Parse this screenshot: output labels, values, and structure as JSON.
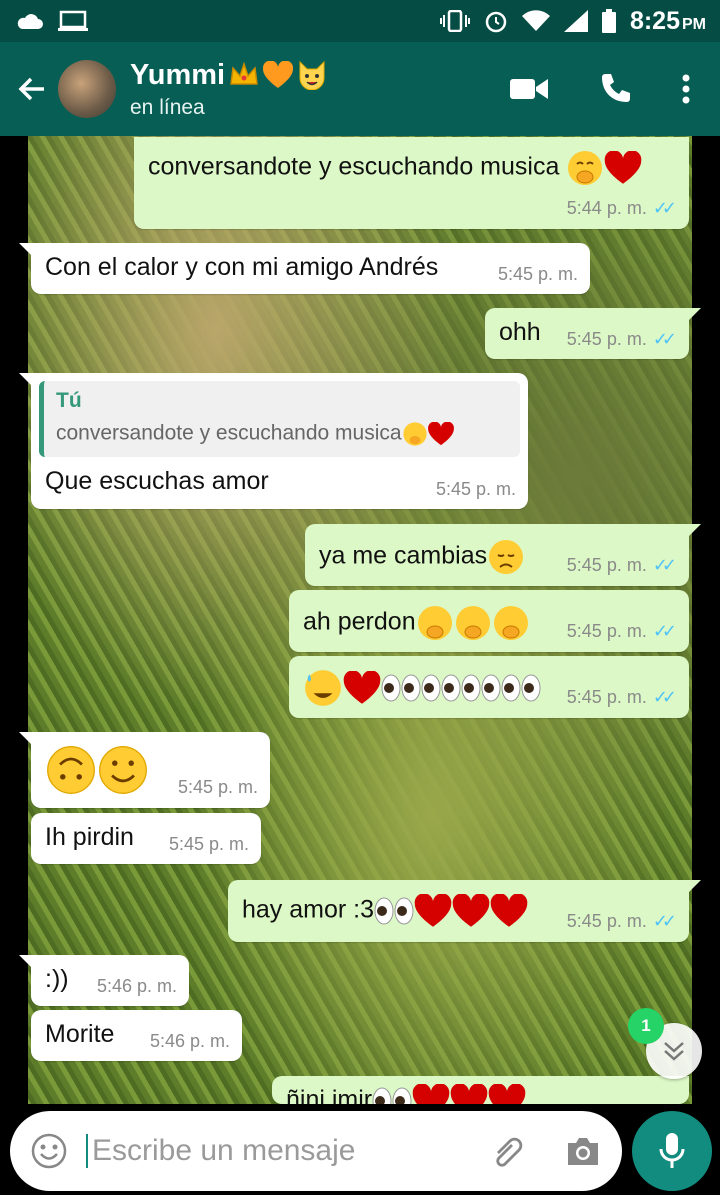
{
  "status_bar": {
    "time": "8:25",
    "ampm": "PM"
  },
  "header": {
    "name": "Yummi",
    "status": "en línea"
  },
  "messages": [
    {
      "dir": "out",
      "text": "conversandote y escuchando musica",
      "time": "5:44 p. m."
    },
    {
      "dir": "in",
      "text": "Con el calor y con mi amigo Andrés",
      "time": "5:45 p. m."
    },
    {
      "dir": "out",
      "text": "ohh",
      "time": "5:45 p. m."
    },
    {
      "dir": "in",
      "quote_author": "Tú",
      "quote_text": "conversandote y escuchando musica",
      "text": "Que escuchas amor",
      "time": "5:45 p. m."
    },
    {
      "dir": "out",
      "text": "ya me cambias",
      "time": "5:45 p. m."
    },
    {
      "dir": "out",
      "text": "ah perdon",
      "time": "5:45 p. m."
    },
    {
      "dir": "out",
      "text": "",
      "time": "5:45 p. m."
    },
    {
      "dir": "in",
      "text": "",
      "time": "5:45 p. m."
    },
    {
      "dir": "in",
      "text": "Ih pirdin",
      "time": "5:45 p. m."
    },
    {
      "dir": "out",
      "text": "hay amor :3",
      "time": "5:45 p. m."
    },
    {
      "dir": "in",
      "text": ":))",
      "time": "5:46 p. m."
    },
    {
      "dir": "in",
      "text": "Morite",
      "time": "5:46 p. m."
    },
    {
      "dir": "out",
      "text": "ñini imir",
      "time": ""
    }
  ],
  "unread_count": "1",
  "composer": {
    "placeholder": "Escribe un mensaje"
  },
  "colors": {
    "header": "#075e54",
    "status_bar": "#054d44",
    "outgoing": "#dcf8c6",
    "incoming": "#ffffff",
    "accent": "#128c7e"
  }
}
